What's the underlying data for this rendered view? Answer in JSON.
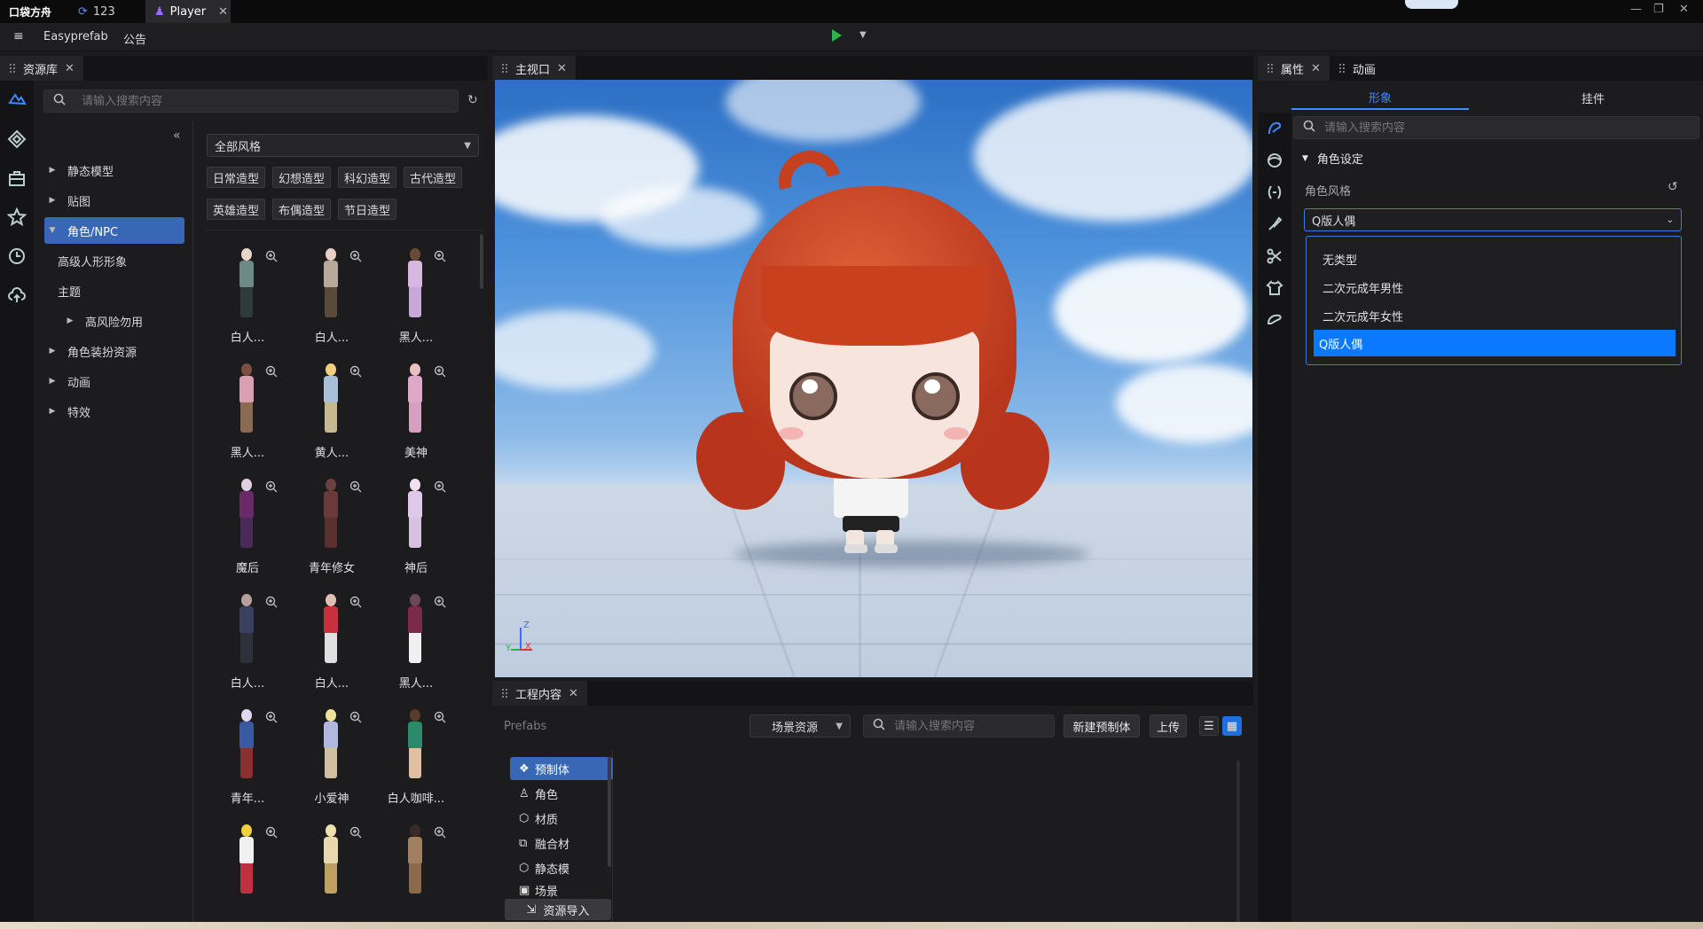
{
  "app": {
    "logo": "口袋方舟"
  },
  "title_tabs": [
    {
      "label": "123"
    },
    {
      "label": "Player"
    }
  ],
  "menu": {
    "project": "Easyprefab",
    "notice": "公告"
  },
  "asset_panel": {
    "tab": "资源库",
    "search_placeholder": "请输入搜索内容",
    "tree": [
      "静态模型",
      "贴图",
      "角色/NPC",
      "高级人形形象",
      "主题",
      "高风险勿用",
      "角色装扮资源",
      "动画",
      "特效"
    ],
    "style_select": "全部风格",
    "chips": [
      "日常造型",
      "幻想造型",
      "科幻造型",
      "古代造型",
      "英雄造型",
      "布偶造型",
      "节日造型"
    ],
    "items": [
      {
        "label": "白人..."
      },
      {
        "label": "白人..."
      },
      {
        "label": "黑人..."
      },
      {
        "label": "黑人..."
      },
      {
        "label": "黄人..."
      },
      {
        "label": "美神"
      },
      {
        "label": "魔后"
      },
      {
        "label": "青年修女"
      },
      {
        "label": "神后"
      },
      {
        "label": "白人..."
      },
      {
        "label": "白人..."
      },
      {
        "label": "黑人..."
      },
      {
        "label": "青年..."
      },
      {
        "label": "小爱神"
      },
      {
        "label": "白人咖啡..."
      },
      {
        "label": ""
      },
      {
        "label": ""
      },
      {
        "label": ""
      }
    ]
  },
  "viewport": {
    "tab": "主视口",
    "axis": {
      "z": "Z",
      "x": "X",
      "y": "Y"
    }
  },
  "project_panel": {
    "tab": "工程内容",
    "breadcrumb": "Prefabs",
    "scene_select": "场景资源",
    "search_placeholder": "请输入搜索内容",
    "new_prefab": "新建预制体",
    "upload": "上传",
    "categories": [
      "预制体",
      "角色",
      "材质",
      "融合材",
      "静态模",
      "场景"
    ],
    "import": "资源导入"
  },
  "props_panel": {
    "tabs": [
      "属性",
      "动画"
    ],
    "subtabs": [
      "形象",
      "挂件"
    ],
    "search_placeholder": "请输入搜索内容",
    "section": "角色设定",
    "field_label": "角色风格",
    "selected": "Q版人偶",
    "options": [
      "无类型",
      "二次元成年男性",
      "二次元成年女性",
      "Q版人偶"
    ]
  },
  "colors": {
    "accent": "#3767b5",
    "selected_option": "#0a78ff",
    "play": "#2fb344",
    "bg": "#1b1b1e"
  }
}
